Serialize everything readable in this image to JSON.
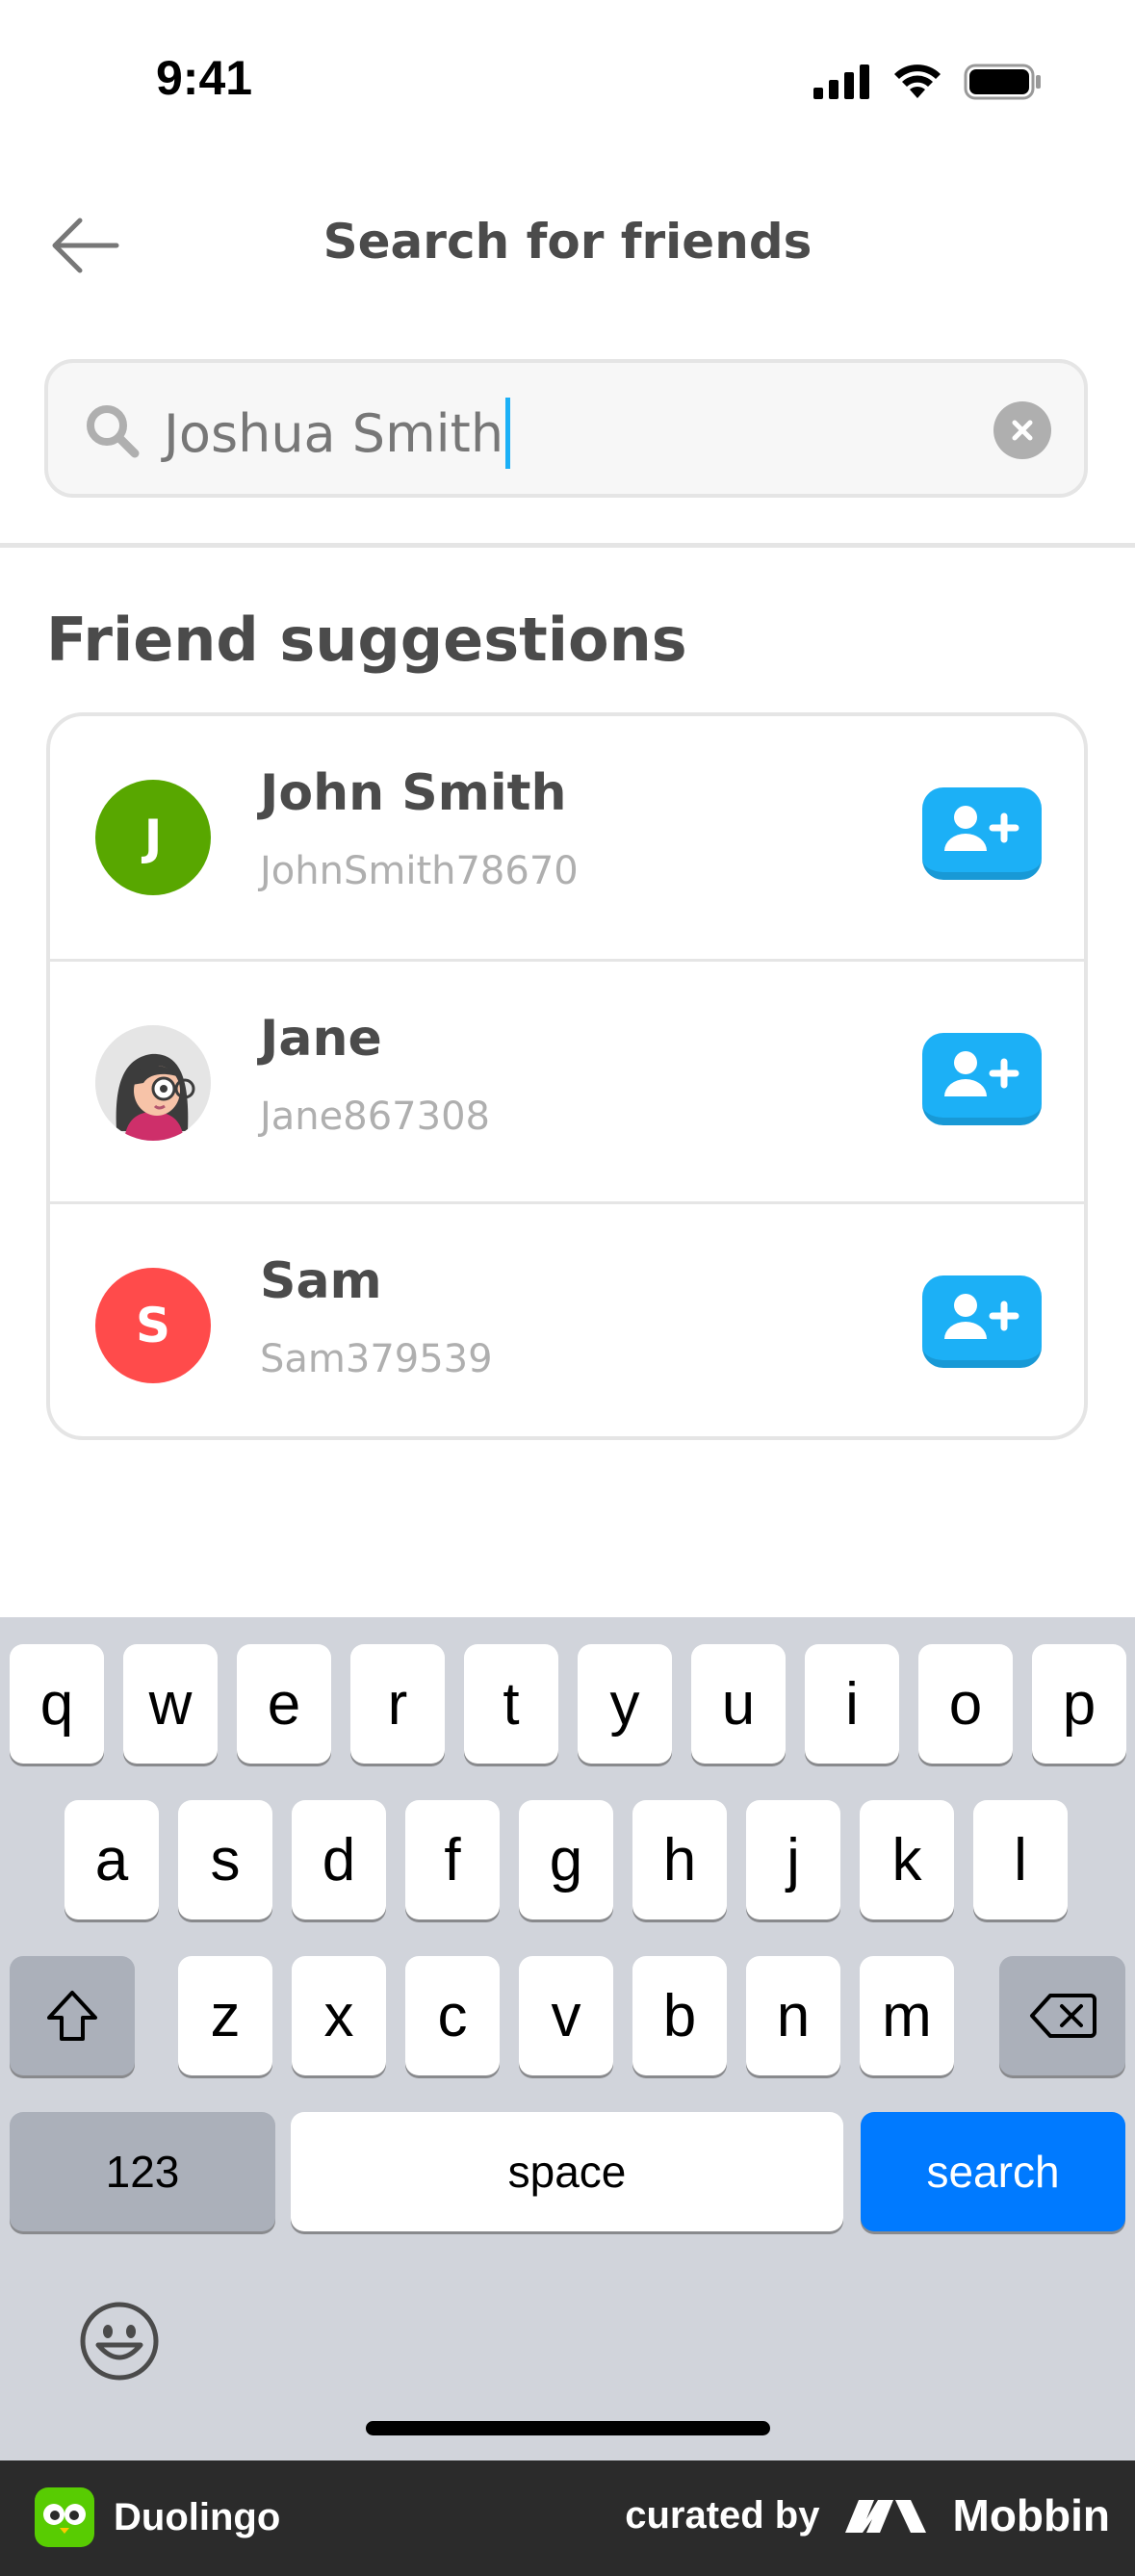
{
  "status_bar": {
    "time": "9:41"
  },
  "header": {
    "title": "Search for friends"
  },
  "search": {
    "value": "Joshua Smith"
  },
  "suggestions": {
    "title": "Friend suggestions",
    "friends": [
      {
        "name": "John Smith",
        "username": "JohnSmith78670",
        "initial": "J",
        "color": "#58a700"
      },
      {
        "name": "Jane",
        "username": "Jane867308",
        "initial": "",
        "color": "#e5e5e5"
      },
      {
        "name": "Sam",
        "username": "Sam379539",
        "initial": "S",
        "color": "#ff4b4b"
      }
    ]
  },
  "keyboard": {
    "row1": [
      "q",
      "w",
      "e",
      "r",
      "t",
      "y",
      "u",
      "i",
      "o",
      "p"
    ],
    "row2": [
      "a",
      "s",
      "d",
      "f",
      "g",
      "h",
      "j",
      "k",
      "l"
    ],
    "row3": [
      "z",
      "x",
      "c",
      "v",
      "b",
      "n",
      "m"
    ],
    "numbers_label": "123",
    "space_label": "space",
    "search_label": "search"
  },
  "footer": {
    "brand": "Duolingo",
    "curated_by": "curated by",
    "mobbin": "Mobbin"
  },
  "colors": {
    "accent": "#1cb0f6",
    "keyboard_action": "#007aff"
  }
}
